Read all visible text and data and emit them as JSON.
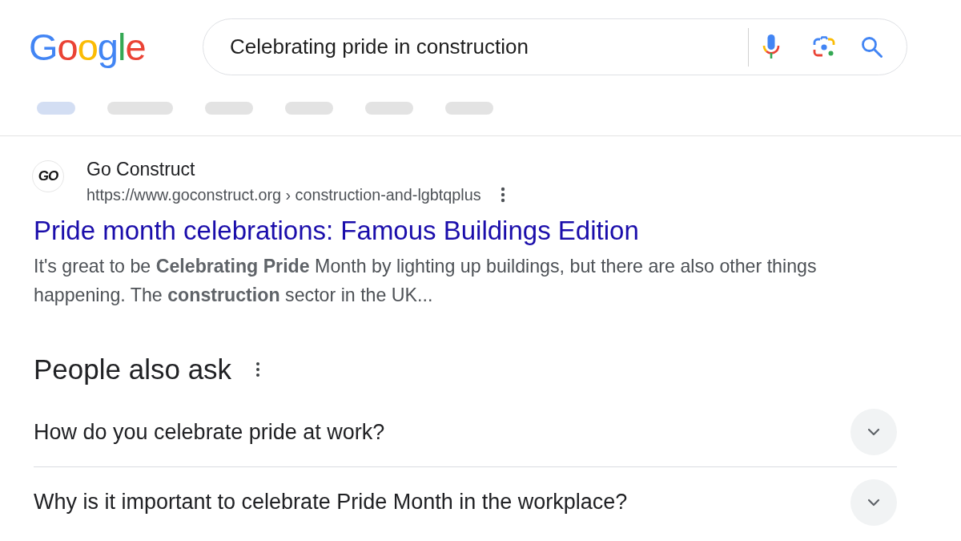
{
  "header": {
    "logo": "Google",
    "search": {
      "value": "Celebrating pride in construction"
    },
    "filter_tabs": [
      {
        "selected": true
      },
      {
        "selected": false
      },
      {
        "selected": false
      },
      {
        "selected": false
      },
      {
        "selected": false
      },
      {
        "selected": false
      }
    ]
  },
  "result": {
    "logo": "GO",
    "site_name": "Go Construct",
    "url": "https://www.goconstruct.org › construction-and-lgbtqplus",
    "title": "Pride month celebrations: Famous Buildings Edition",
    "snippet": "It's great to be **Celebrating Pride** Month by lighting up buildings, but there are also other things happening. The **construction** sector in the UK..."
  },
  "people_also_ask": {
    "heading": "People also ask",
    "questions": [
      {
        "text": "How do you celebrate pride at work?",
        "expanded": false
      },
      {
        "text": "Why is it important to celebrate Pride Month in the workplace?",
        "expanded": false
      }
    ]
  }
}
